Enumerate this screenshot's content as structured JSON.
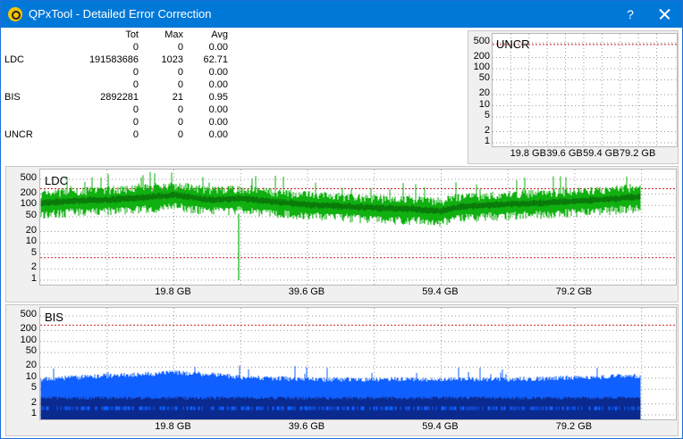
{
  "window": {
    "title": "QPxTool - Detailed Error Correction",
    "help_label": "?"
  },
  "icons": {
    "app": "qpxtool-app-icon",
    "close": "close-icon"
  },
  "stats": {
    "headers": {
      "tot": "Tot",
      "max": "Max",
      "avg": "Avg"
    },
    "rows": [
      {
        "label": "",
        "tot": "0",
        "max": "0",
        "avg": "0.00"
      },
      {
        "label": "LDC",
        "tot": "191583686",
        "max": "1023",
        "avg": "62.71"
      },
      {
        "label": "",
        "tot": "0",
        "max": "0",
        "avg": "0.00"
      },
      {
        "label": "",
        "tot": "0",
        "max": "0",
        "avg": "0.00"
      },
      {
        "label": "BIS",
        "tot": "2892281",
        "max": "21",
        "avg": "0.95"
      },
      {
        "label": "",
        "tot": "0",
        "max": "0",
        "avg": "0.00"
      },
      {
        "label": "",
        "tot": "0",
        "max": "0",
        "avg": "0.00"
      },
      {
        "label": "UNCR",
        "tot": "0",
        "max": "0",
        "avg": "0.00"
      }
    ]
  },
  "colors": {
    "ldc": "#10b010",
    "ldc_dark": "#0a7a0a",
    "bis": "#1060ff",
    "bis_dark": "#0a2a90",
    "limit": "#cc2222",
    "grid": "#9a9a9a"
  },
  "chart_data": [
    {
      "type": "line",
      "title": "UNCR",
      "y_scale": "log",
      "y_ticks": [
        "500",
        "200",
        "100",
        "50",
        "20",
        "10",
        "5",
        "2",
        "1"
      ],
      "x_ticks": [
        "19.8 GB",
        "39.6 GB",
        "59.4 GB",
        "79.2 GB"
      ],
      "series": []
    },
    {
      "type": "area",
      "title": "LDC",
      "y_scale": "log",
      "y_ticks": [
        "500",
        "200",
        "100",
        "50",
        "20",
        "10",
        "5",
        "2",
        "1"
      ],
      "x_ticks": [
        "19.8 GB",
        "39.6 GB",
        "59.4 GB",
        "79.2 GB"
      ],
      "x_max_gb": 100,
      "series": [
        {
          "x": [
            0,
            5,
            10,
            15,
            20,
            22,
            25,
            30,
            35,
            40,
            45,
            50,
            55,
            59.4,
            62,
            65,
            70,
            75,
            80,
            85,
            89
          ],
          "values": [
            120,
            140,
            150,
            170,
            200,
            180,
            150,
            160,
            130,
            110,
            100,
            90,
            85,
            75,
            95,
            105,
            115,
            125,
            140,
            160,
            180
          ]
        }
      ]
    },
    {
      "type": "area",
      "title": "BIS",
      "y_scale": "log",
      "y_ticks": [
        "500",
        "200",
        "100",
        "50",
        "20",
        "10",
        "5",
        "2",
        "1"
      ],
      "x_ticks": [
        "19.8 GB",
        "39.6 GB",
        "59.4 GB",
        "79.2 GB"
      ],
      "x_max_gb": 100,
      "series": [
        {
          "x": [
            0,
            10,
            20,
            25,
            30,
            40,
            50,
            60,
            70,
            80,
            89
          ],
          "values": [
            8,
            10,
            12,
            11,
            9,
            8,
            8,
            8,
            8,
            9,
            10
          ]
        }
      ]
    }
  ]
}
